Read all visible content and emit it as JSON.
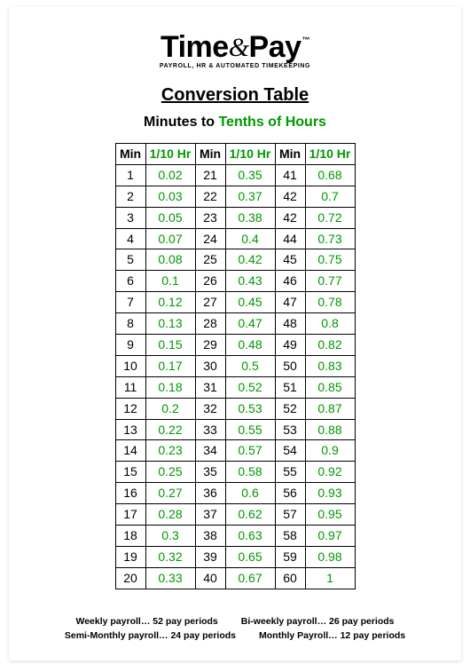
{
  "logo": {
    "brand_a": "Time",
    "brand_amp": "&",
    "brand_b": "Pay",
    "tm": "™",
    "tagline": "PAYROLL, HR & AUTOMATED TIMEKEEPING"
  },
  "title": "Conversion Table",
  "subtitle_black": "Minutes to ",
  "subtitle_green": "Tenths of Hours",
  "headers": {
    "min": "Min",
    "hr": "1/10 Hr"
  },
  "chart_data": {
    "type": "table",
    "title": "Minutes to Tenths of Hours Conversion",
    "columns": [
      "Min",
      "1/10 Hr"
    ],
    "rows": [
      [
        1,
        "0.02"
      ],
      [
        2,
        "0.03"
      ],
      [
        3,
        "0.05"
      ],
      [
        4,
        "0.07"
      ],
      [
        5,
        "0.08"
      ],
      [
        6,
        "0.1"
      ],
      [
        7,
        "0.12"
      ],
      [
        8,
        "0.13"
      ],
      [
        9,
        "0.15"
      ],
      [
        10,
        "0.17"
      ],
      [
        11,
        "0.18"
      ],
      [
        12,
        "0.2"
      ],
      [
        13,
        "0.22"
      ],
      [
        14,
        "0.23"
      ],
      [
        15,
        "0.25"
      ],
      [
        16,
        "0.27"
      ],
      [
        17,
        "0.28"
      ],
      [
        18,
        "0.3"
      ],
      [
        19,
        "0.32"
      ],
      [
        20,
        "0.33"
      ],
      [
        21,
        "0.35"
      ],
      [
        22,
        "0.37"
      ],
      [
        23,
        "0.38"
      ],
      [
        24,
        "0.4"
      ],
      [
        25,
        "0.42"
      ],
      [
        26,
        "0.43"
      ],
      [
        27,
        "0.45"
      ],
      [
        28,
        "0.47"
      ],
      [
        29,
        "0.48"
      ],
      [
        30,
        "0.5"
      ],
      [
        31,
        "0.52"
      ],
      [
        32,
        "0.53"
      ],
      [
        33,
        "0.55"
      ],
      [
        34,
        "0.57"
      ],
      [
        35,
        "0.58"
      ],
      [
        36,
        "0.6"
      ],
      [
        37,
        "0.62"
      ],
      [
        38,
        "0.63"
      ],
      [
        39,
        "0.65"
      ],
      [
        40,
        "0.67"
      ],
      [
        41,
        "0.68"
      ],
      [
        42,
        "0.7"
      ],
      [
        42,
        "0.72"
      ],
      [
        44,
        "0.73"
      ],
      [
        45,
        "0.75"
      ],
      [
        46,
        "0.77"
      ],
      [
        47,
        "0.78"
      ],
      [
        48,
        "0.8"
      ],
      [
        49,
        "0.82"
      ],
      [
        50,
        "0.83"
      ],
      [
        51,
        "0.85"
      ],
      [
        52,
        "0.87"
      ],
      [
        53,
        "0.88"
      ],
      [
        54,
        "0.9"
      ],
      [
        55,
        "0.92"
      ],
      [
        56,
        "0.93"
      ],
      [
        57,
        "0.95"
      ],
      [
        58,
        "0.97"
      ],
      [
        59,
        "0.98"
      ],
      [
        60,
        "1"
      ]
    ]
  },
  "footer": {
    "l1a": "Weekly payroll… 52 pay periods",
    "l1b": "Bi-weekly payroll… 26 pay periods",
    "l2a": "Semi-Monthly payroll… 24 pay periods",
    "l2b": "Monthly Payroll… 12 pay periods"
  }
}
